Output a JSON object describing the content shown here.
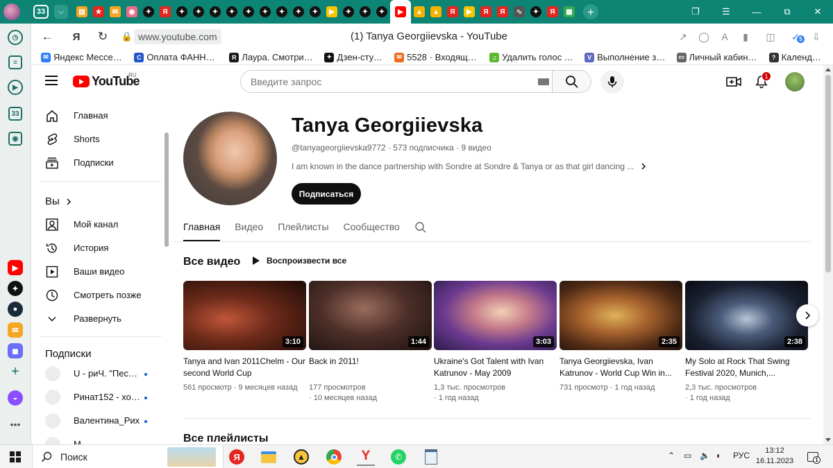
{
  "browser": {
    "tab_count": "33",
    "tab_icons": [
      "dashboard",
      "yandex-star",
      "mail",
      "brain",
      "sparkle",
      "yandex",
      "sparkle",
      "sparkle",
      "sparkle",
      "sparkle",
      "sparkle",
      "sparkle",
      "sparkle",
      "sparkle",
      "sparkle",
      "yandex-music",
      "sparkle",
      "sparkle",
      "sparkle",
      "youtube",
      "mountain",
      "mountain",
      "yandex",
      "yandex-music",
      "yandex",
      "yandex",
      "pulse",
      "sparkle",
      "yandex",
      "sheets"
    ],
    "active_tab_index": 19,
    "url": "www.youtube.com",
    "page_title": "(1) Tanya Georgiievska - YouTube",
    "notification_count": "5",
    "bookmarks": [
      {
        "label": "Яндекс Мессендж",
        "icon": "messenger-icon",
        "color": "#2f7ff6"
      },
      {
        "label": "Оплата ФАННЕТ-Т",
        "icon": "fannet-icon",
        "color": "#2255cc"
      },
      {
        "label": "Лаура. Смотрите о",
        "icon": "r-icon",
        "color": "#1a1a1a"
      },
      {
        "label": "Дзен-студия",
        "icon": "dzen-icon",
        "color": "#111111"
      },
      {
        "label": "5528 · Входящие –",
        "icon": "mail-icon",
        "color": "#ee6b1d"
      },
      {
        "label": "Удалить голос из а",
        "icon": "voice-icon",
        "color": "#5cb82e"
      },
      {
        "label": "Выполнение зада",
        "icon": "v-icon",
        "color": "#5c6bc0"
      },
      {
        "label": "Личный кабинет с",
        "icon": "document-icon",
        "color": "#666666"
      },
      {
        "label": "Календарь",
        "icon": "question-icon",
        "color": "#333333"
      }
    ]
  },
  "youtube": {
    "logo_text": "YouTube",
    "region": "RU",
    "search_placeholder": "Введите запрос",
    "notifications": "1",
    "sidebar": {
      "main": [
        {
          "label": "Главная",
          "icon": "home-icon"
        },
        {
          "label": "Shorts",
          "icon": "shorts-icon"
        },
        {
          "label": "Подписки",
          "icon": "subscriptions-icon"
        }
      ],
      "you_header": "Вы",
      "you": [
        {
          "label": "Мой канал",
          "icon": "my-channel-icon"
        },
        {
          "label": "История",
          "icon": "history-icon"
        },
        {
          "label": "Ваши видео",
          "icon": "your-videos-icon"
        },
        {
          "label": "Смотреть позже",
          "icon": "watch-later-icon"
        },
        {
          "label": "Развернуть",
          "icon": "chevron-down-icon"
        }
      ],
      "subs_header": "Подписки",
      "subscriptions": [
        {
          "label": "U - риЧ. \"Песни ...",
          "new": true
        },
        {
          "label": "Ринат152 - хобб...",
          "new": true
        },
        {
          "label": "Валентина_Рих",
          "new": true
        },
        {
          "label": "М...",
          "new": false
        }
      ]
    },
    "channel": {
      "name": "Tanya Georgiievska",
      "handle": "@tanyageorgiievska9772",
      "subscribers": "573 подписчика",
      "videos_count": "9 видео",
      "description": "I am known in the dance partnership with Sondre at Sondre & Tanya or as that girl dancing ...",
      "subscribe_label": "Подписаться",
      "tabs": [
        "Главная",
        "Видео",
        "Плейлисты",
        "Сообщество"
      ],
      "active_tab": 0
    },
    "section_title": "Все видео",
    "play_all": "Воспроизвести все",
    "videos": [
      {
        "title": "Tanya and Ivan 2011Chelm - Our second World Cup",
        "duration": "3:10",
        "views": "561 просмотр",
        "age": "9 месяцев назад"
      },
      {
        "title": "Back in 2011!",
        "duration": "1:44",
        "views": "177 просмотров",
        "age": "10 месяцев назад"
      },
      {
        "title": "Ukraine's Got Talent with Ivan Katrunov - May 2009",
        "duration": "3:03",
        "views": "1,3 тыс. просмотров",
        "age": "1 год назад"
      },
      {
        "title": "Tanya Georgiievska, Ivan Katrunov - World Cup Win in...",
        "duration": "2:35",
        "views": "731 просмотр",
        "age": "1 год назад"
      },
      {
        "title": "My Solo at Rock That Swing Festival 2020, Munich,...",
        "duration": "2:38",
        "views": "2,3 тыс. просмотров",
        "age": "1 год назад"
      }
    ],
    "section2_title": "Все плейлисты"
  },
  "taskbar": {
    "search_label": "Поиск",
    "language": "РУС",
    "time": "13:12",
    "date": "16.11.2023",
    "notification_count": "1"
  },
  "colors": {
    "tabbar": "#0d8474",
    "youtube_red": "#ff0000",
    "subscribe_bg": "#0f0f0f"
  }
}
